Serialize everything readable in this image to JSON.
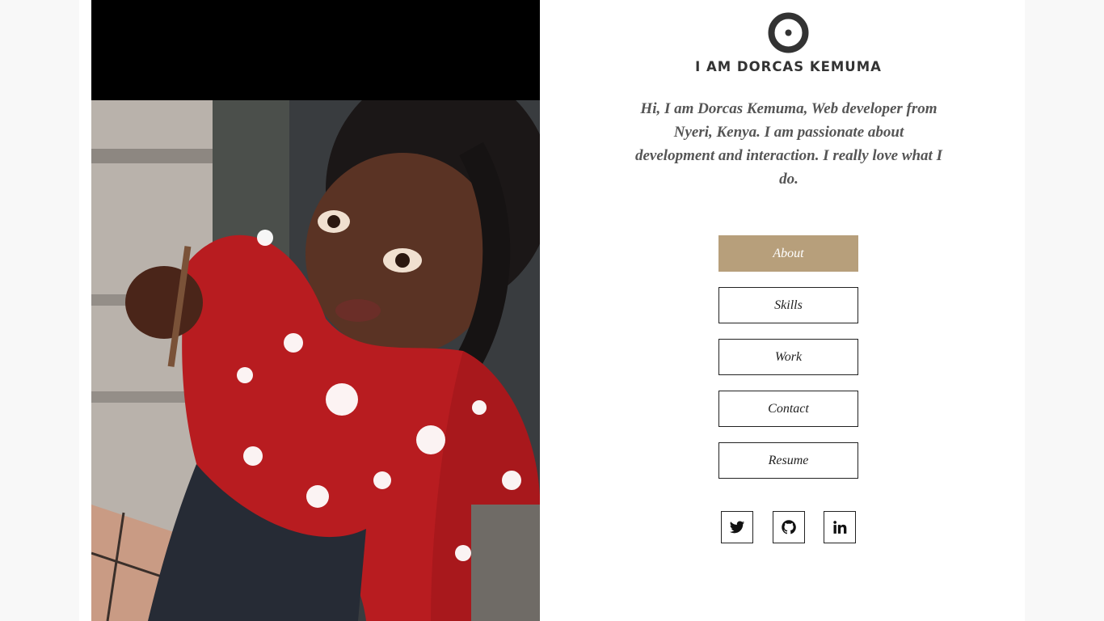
{
  "profile": {
    "heading": "I AM DORCAS KEMUMA",
    "intro": "Hi, I am Dorcas Kemuma, Web developer from Nyeri, Kenya. I am passionate about development and interaction. I really love what I do.",
    "photo_icon": "portrait-photo"
  },
  "nav": {
    "items": [
      {
        "label": "About",
        "active": true
      },
      {
        "label": "Skills",
        "active": false
      },
      {
        "label": "Work",
        "active": false
      },
      {
        "label": "Contact",
        "active": false
      },
      {
        "label": "Resume",
        "active": false
      }
    ]
  },
  "social": {
    "items": [
      {
        "icon": "twitter-icon"
      },
      {
        "icon": "github-icon"
      },
      {
        "icon": "linkedin-icon"
      }
    ]
  },
  "colors": {
    "accent": "#b79f7b",
    "text": "#222222",
    "intro_text": "#555555",
    "background": "#ffffff",
    "outer_background": "#f8f8f8"
  }
}
